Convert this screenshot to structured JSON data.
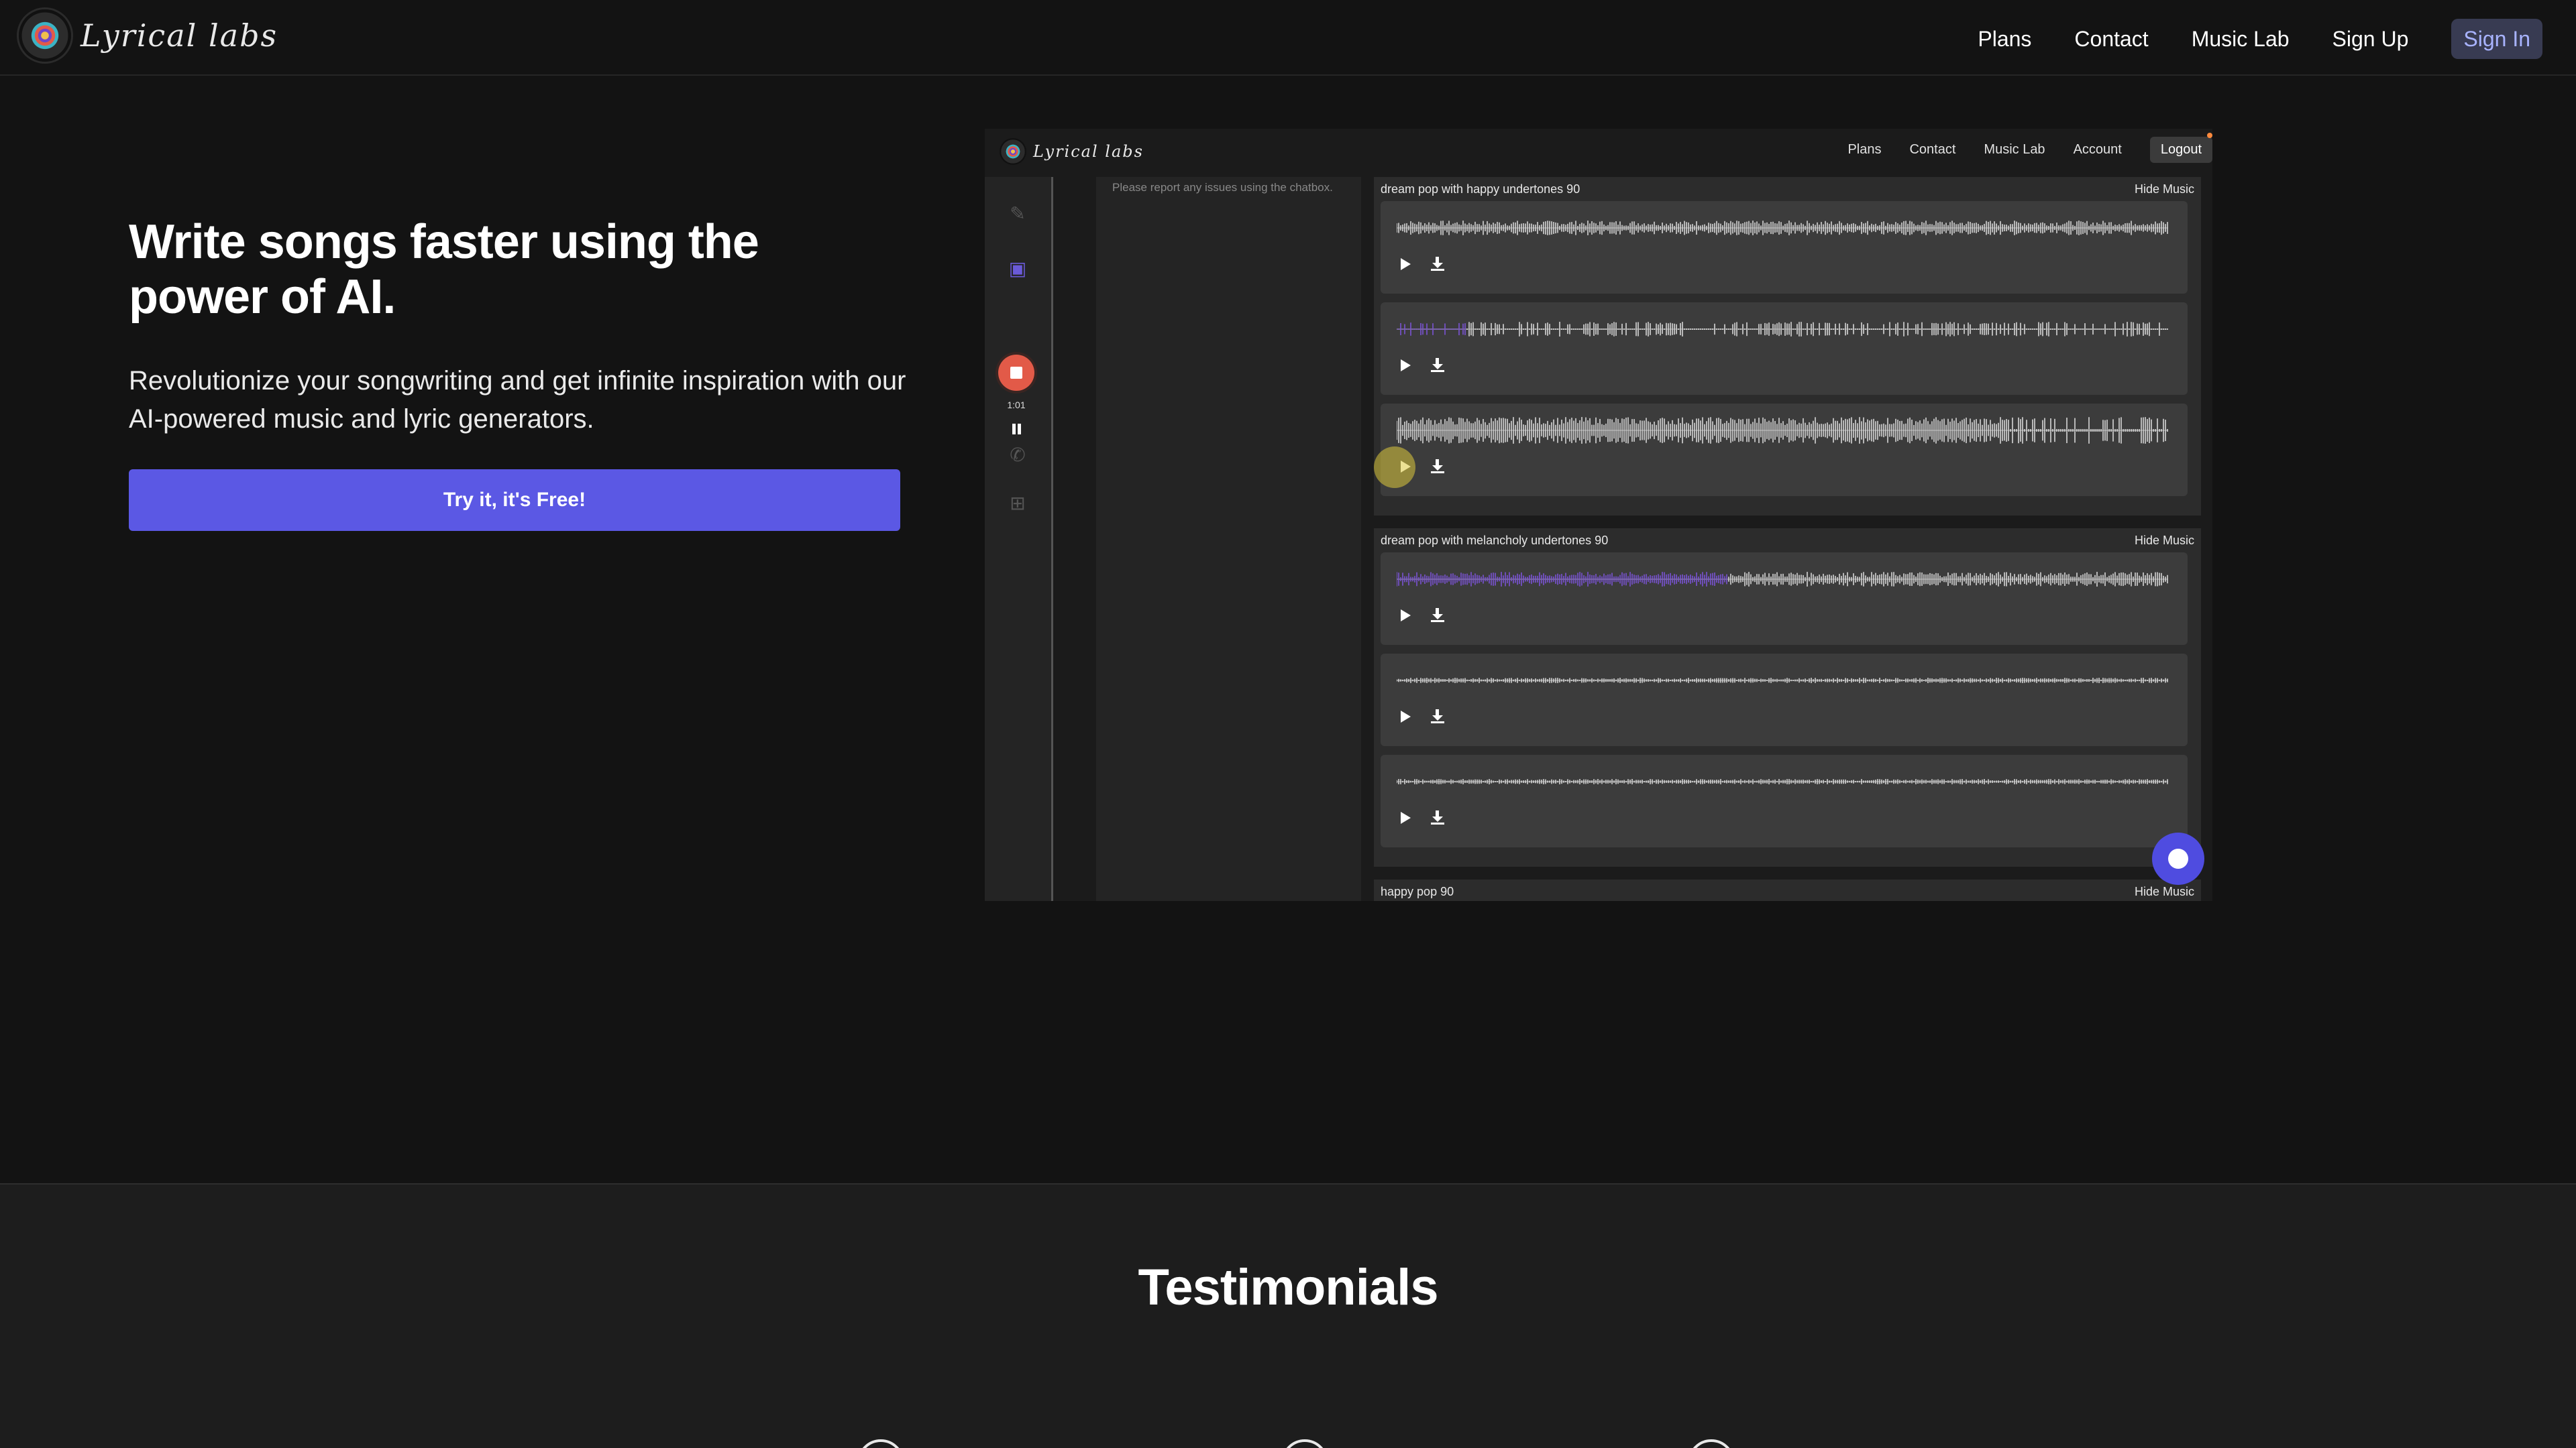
{
  "brand": {
    "name": "Lyrical labs"
  },
  "nav": {
    "links": [
      "Plans",
      "Contact",
      "Music Lab",
      "Sign Up"
    ],
    "signin": "Sign In"
  },
  "hero": {
    "title": "Write songs faster using the power of AI.",
    "subtitle": "Revolutionize your songwriting and get infinite inspiration with our AI-powered music and lyric generators.",
    "cta": "Try it, it's Free!"
  },
  "preview": {
    "nav": [
      "Plans",
      "Contact",
      "Music Lab",
      "Account"
    ],
    "logout": "Logout",
    "record_time": "1:01",
    "notice": "Please report any issues using the chatbox.",
    "hide_label": "Hide Music",
    "groups": [
      {
        "title": "dream pop with happy undertones 90",
        "tracks": 3
      },
      {
        "title": "dream pop with melancholy undertones 90",
        "tracks": 3
      },
      {
        "title": "happy pop 90",
        "tracks": 0
      }
    ]
  },
  "testimonials": {
    "title": "Testimonials"
  },
  "colors": {
    "accent": "#5b58e4",
    "record": "#e25a48",
    "waveform_progress": "#7a52d6"
  }
}
